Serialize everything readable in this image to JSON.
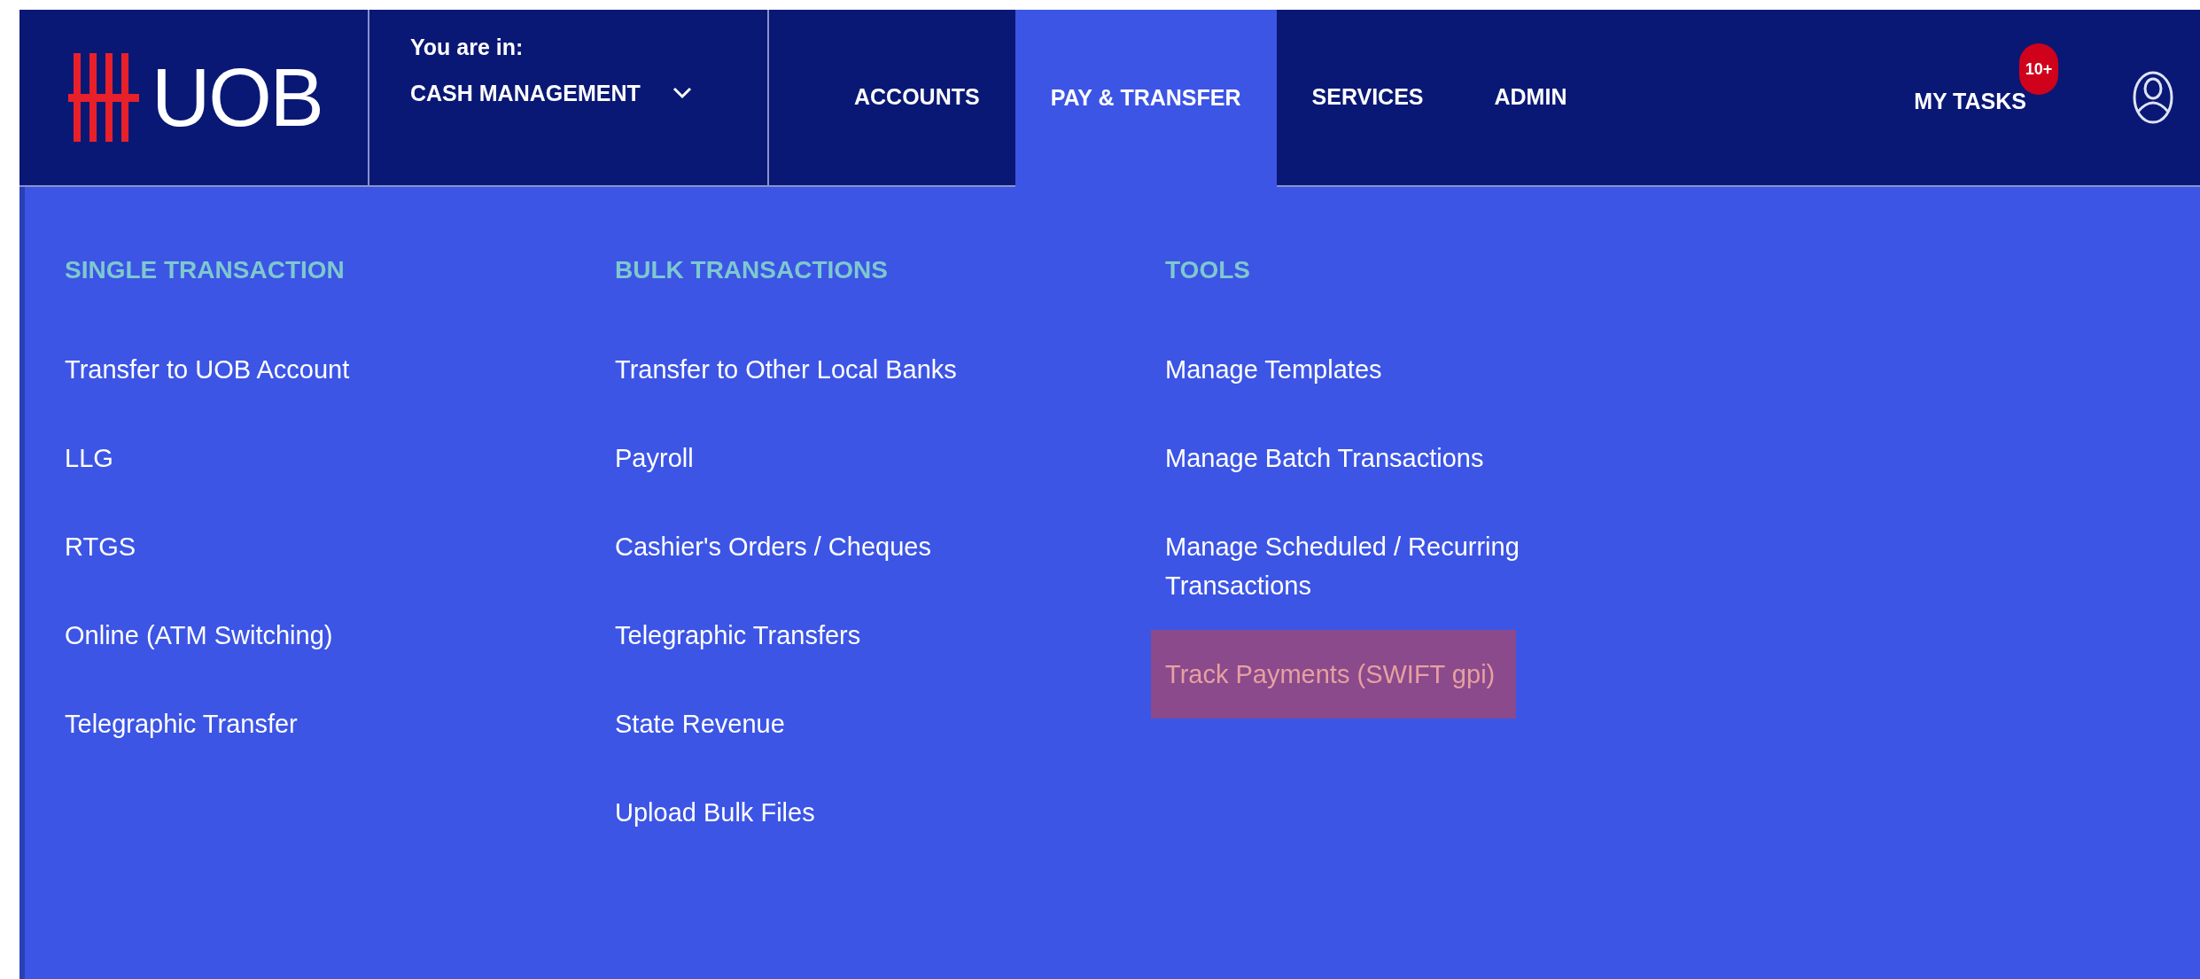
{
  "header": {
    "logo": "UOB",
    "context_label": "You are in:",
    "context_value": "CASH MANAGEMENT",
    "nav": [
      {
        "label": "ACCOUNTS",
        "selected": false
      },
      {
        "label": "PAY & TRANSFER",
        "selected": true
      },
      {
        "label": "SERVICES",
        "selected": false
      },
      {
        "label": "ADMIN",
        "selected": false
      }
    ],
    "tasks": {
      "label": "MY TASKS",
      "badge": "10+"
    }
  },
  "menu": {
    "columns": [
      {
        "heading": "SINGLE TRANSACTION",
        "items": [
          {
            "label": "Transfer to UOB Account",
            "selected": false
          },
          {
            "label": "LLG",
            "selected": false
          },
          {
            "label": "RTGS",
            "selected": false
          },
          {
            "label": "Online (ATM Switching)",
            "selected": false
          },
          {
            "label": "Telegraphic Transfer",
            "selected": false
          }
        ]
      },
      {
        "heading": "BULK TRANSACTIONS",
        "items": [
          {
            "label": "Transfer to Other Local Banks",
            "selected": false
          },
          {
            "label": "Payroll",
            "selected": false
          },
          {
            "label": "Cashier's Orders / Cheques",
            "selected": false
          },
          {
            "label": "Telegraphic Transfers",
            "selected": false
          },
          {
            "label": "State Revenue",
            "selected": false
          },
          {
            "label": "Upload Bulk Files",
            "selected": false
          }
        ]
      },
      {
        "heading": "TOOLS",
        "items": [
          {
            "label": "Manage Templates",
            "selected": false
          },
          {
            "label": "Manage Batch Transactions",
            "selected": false
          },
          {
            "label": "Manage Scheduled / Recurring Transactions",
            "selected": false
          },
          {
            "label": "Track Payments (SWIFT gpi)",
            "selected": true
          }
        ]
      }
    ]
  }
}
